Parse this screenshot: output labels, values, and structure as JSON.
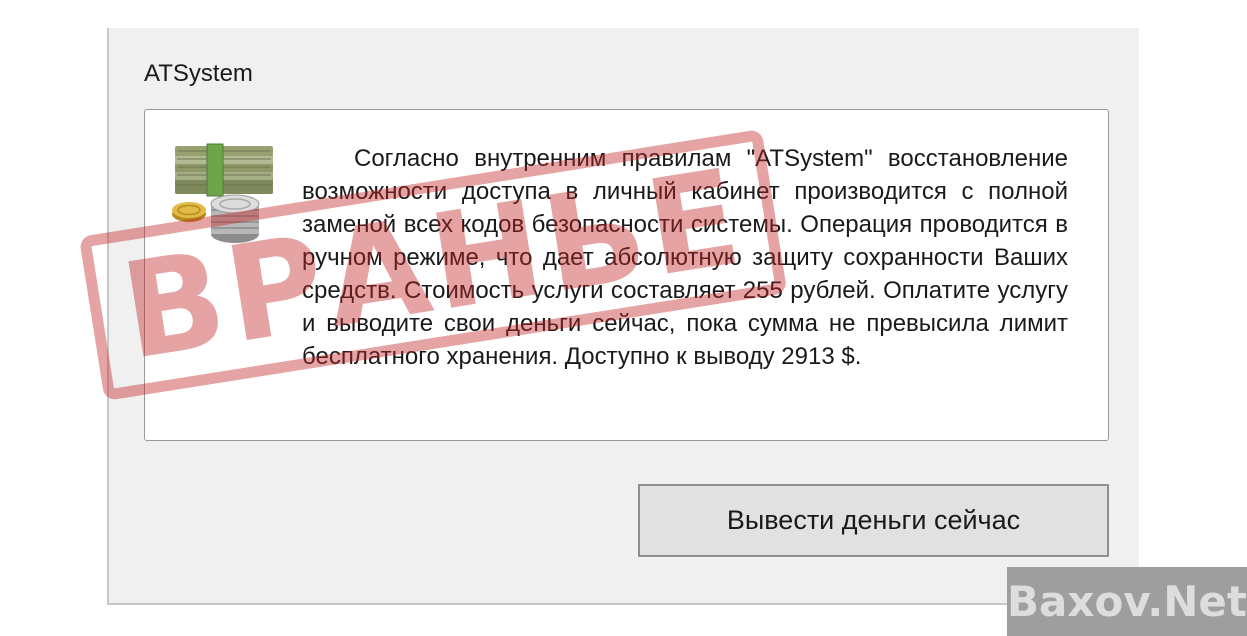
{
  "window": {
    "title": "ATSystem"
  },
  "message": {
    "text": "Согласно внутренним правилам \"ATSystem\" восстановление возможности доступа в личный кабинет производится с полной заменой всех кодов безопасности системы. Операция проводится в ручном режиме, что дает абсолютную защиту сохранности Ваших средств. Стоимость услуги составляет 255 рублей. Оплатите услугу и выводите свои деньги сейчас, пока сумма не превысила лимит бесплатного хранения. Доступно к выводу 2913 $.",
    "icon": "money-icon"
  },
  "action": {
    "button_label": "Вывести деньги сейчас"
  },
  "overlay": {
    "stamp_text": "ВРАНЬЕ",
    "watermark_text": "Baxov.Net"
  }
}
